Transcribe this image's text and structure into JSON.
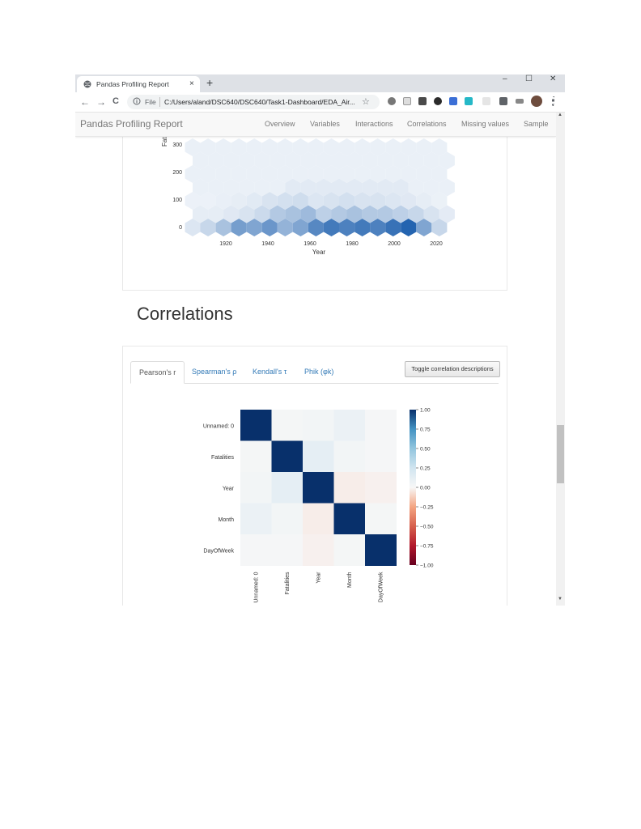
{
  "browser": {
    "tab_title": "Pandas Profiling Report",
    "tab_close": "×",
    "new_tab": "+",
    "win_min": "–",
    "win_max": "☐",
    "win_close": "✕",
    "back": "←",
    "forward": "→",
    "reload": "C",
    "scheme": "File",
    "url": "C:/Users/aland/DSC640/DSC640/Task1-Dashboard/EDA_Air...",
    "star": "☆"
  },
  "navbar": {
    "brand": "Pandas Profiling Report",
    "links": [
      "Overview",
      "Variables",
      "Interactions",
      "Correlations",
      "Missing values",
      "Sample"
    ]
  },
  "hexbin": {
    "ylabel": "Fatalities",
    "xlabel": "Year",
    "yticks": [
      "300",
      "200",
      "100",
      "0"
    ],
    "xticks": [
      "1920",
      "1940",
      "1960",
      "1980",
      "2000",
      "2020"
    ]
  },
  "correlations": {
    "title": "Correlations",
    "tabs": [
      "Pearson's r",
      "Spearman's ρ",
      "Kendall's τ",
      "Phik (φk)"
    ],
    "active_tab": 0,
    "toggle_button": "Toggle correlation descriptions"
  },
  "chart_data": {
    "type": "heatmap",
    "variables": [
      "Unnamed: 0",
      "Fatalities",
      "Year",
      "Month",
      "DayOfWeek"
    ],
    "values": [
      [
        1.0,
        0.02,
        0.03,
        0.08,
        0.01
      ],
      [
        0.02,
        1.0,
        0.12,
        0.03,
        0.01
      ],
      [
        0.03,
        0.12,
        1.0,
        -0.03,
        -0.02
      ],
      [
        0.08,
        0.03,
        -0.03,
        1.0,
        0.02
      ],
      [
        0.01,
        0.01,
        -0.02,
        0.02,
        1.0
      ]
    ],
    "colorbar_ticks": [
      "1.00",
      "0.75",
      "0.50",
      "0.25",
      "0.00",
      "−0.25",
      "−0.50",
      "−0.75",
      "−1.00"
    ],
    "vmin": -1,
    "vmax": 1,
    "colormap": "RdBu",
    "colors": {
      "high": "#08306b",
      "mid": "#f7f7f7",
      "low": "#67001f"
    }
  }
}
